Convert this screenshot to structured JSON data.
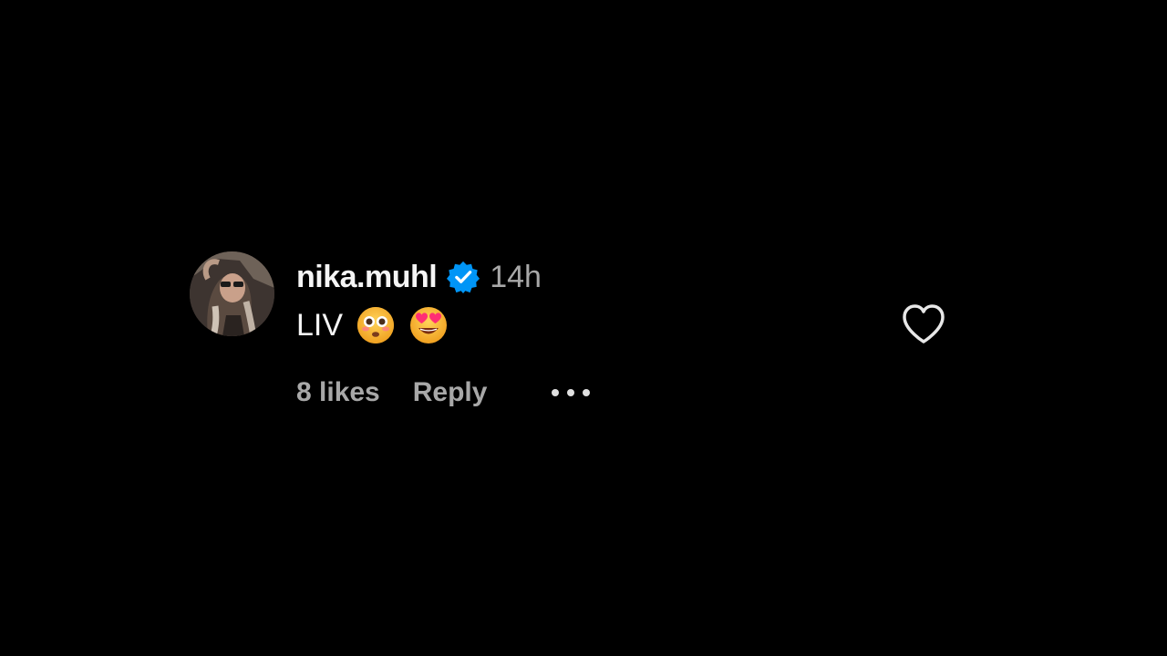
{
  "comment": {
    "avatar_icon": "user-avatar-photo",
    "username": "nika.muhl",
    "verified_icon": "verified-badge-icon",
    "time_ago": "14h",
    "text": "LIV",
    "emojis": [
      "flushed-face-emoji",
      "heart-eyes-emoji"
    ],
    "likes_label": "8 likes",
    "reply_label": "Reply",
    "more_icon": "more-options-icon",
    "like_icon": "heart-icon"
  },
  "colors": {
    "background": "#000000",
    "primary_text": "#f5f5f5",
    "secondary_text": "#a8a8a8",
    "verified_blue": "#0095f6"
  }
}
